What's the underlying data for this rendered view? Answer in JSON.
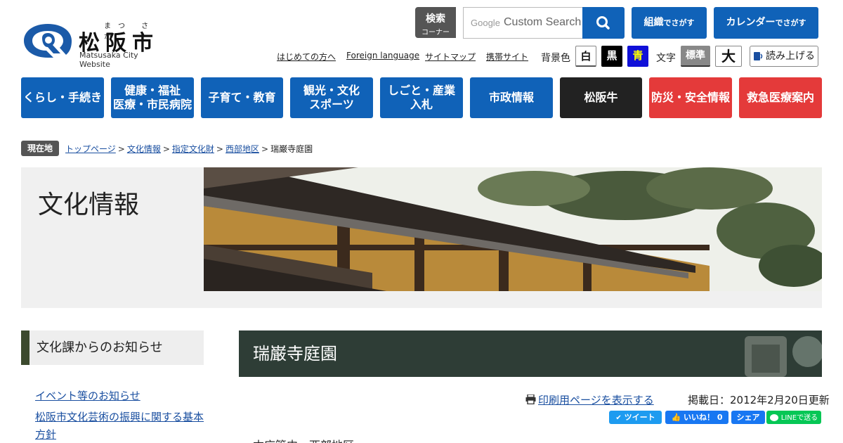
{
  "header": {
    "logo_ruby": "まつ さか",
    "logo_name": "松阪市",
    "logo_sub": "Matsusaka City Website",
    "search_label_1": "検索",
    "search_label_2": "コーナー",
    "search_placeholder": "Custom Search",
    "btn_org": "組織",
    "btn_org_small": "でさがす",
    "btn_cal": "カレンダー",
    "btn_cal_small": "でさがす"
  },
  "util_links": [
    "はじめての方へ",
    "Foreign language",
    "サイトマップ",
    "携帯サイト"
  ],
  "bg_color_label": "背景色",
  "bg_options": [
    "白",
    "黒",
    "青"
  ],
  "font_label": "文字",
  "font_options": [
    "標準",
    "大"
  ],
  "read_aloud": "読み上げる",
  "gnav": [
    "くらし・手続き",
    "健康・福祉\n医療・市民病院",
    "子育て・教育",
    "観光・文化\nスポーツ",
    "しごと・産業\n入札",
    "市政情報",
    "松阪牛",
    "防災・安全情報",
    "救急医療案内"
  ],
  "colors": {
    "nav_blue": "#1062b8",
    "nav_black": "#222222",
    "nav_red": "#e43a3a",
    "sidebar_accent": "#3c4a2e"
  },
  "breadcrumb": {
    "label": "現在地",
    "items": [
      "トップページ",
      "文化情報",
      "指定文化財",
      "西部地区"
    ],
    "current": "瑞巌寺庭園"
  },
  "hero": {
    "title": "文化情報"
  },
  "sidebar": {
    "heading": "文化課からのお知らせ",
    "links": [
      "イベント等のお知らせ",
      "松阪市文化芸術の振興に関する基本方針"
    ]
  },
  "main": {
    "title": "瑞巌寺庭園",
    "print_link": "印刷用ページを表示する",
    "updated": "掲載日：2012年2月20日更新",
    "share": {
      "tweet": "ツイート",
      "like": "いいね！ 0",
      "share": "シェア",
      "line": "LINEで送る"
    },
    "body_start": "本庁管内　西部地区"
  }
}
